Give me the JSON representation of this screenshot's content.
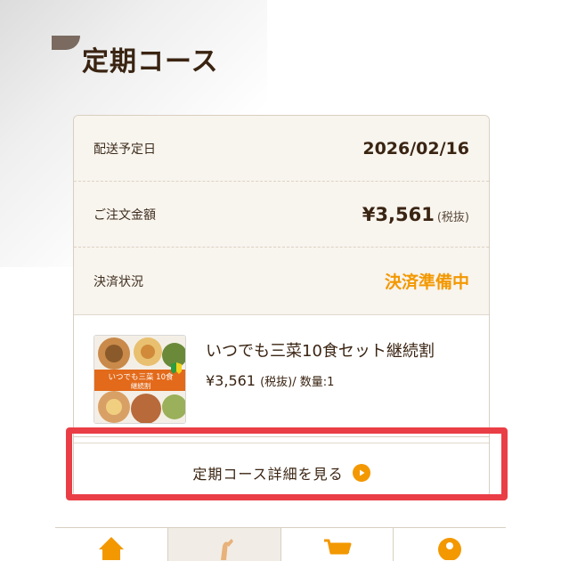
{
  "header": {
    "title": "定期コース"
  },
  "order": {
    "delivery_label": "配送予定日",
    "delivery_date": "2026/02/16",
    "amount_label": "ご注文金額",
    "amount": "¥3,561",
    "amount_tax": "(税抜)",
    "payment_label": "決済状況",
    "payment_status": "決済準備中"
  },
  "product": {
    "name": "いつでも三菜10食セット継続割",
    "price": "¥3,561",
    "price_tax": "(税抜)",
    "quantity": "/ 数量:1",
    "image_text_line1": "いつでも三菜 10食",
    "image_text_line2": "継続割"
  },
  "detail_link": {
    "label": "定期コース詳細を見る"
  },
  "tabbar": {
    "icons": [
      "home-icon",
      "recipe-icon",
      "cart-icon",
      "account-icon"
    ]
  },
  "colors": {
    "accent": "#f39800",
    "highlight": "#ea3e46",
    "text": "#3a2412",
    "summary_bg": "#f8f4ee"
  }
}
